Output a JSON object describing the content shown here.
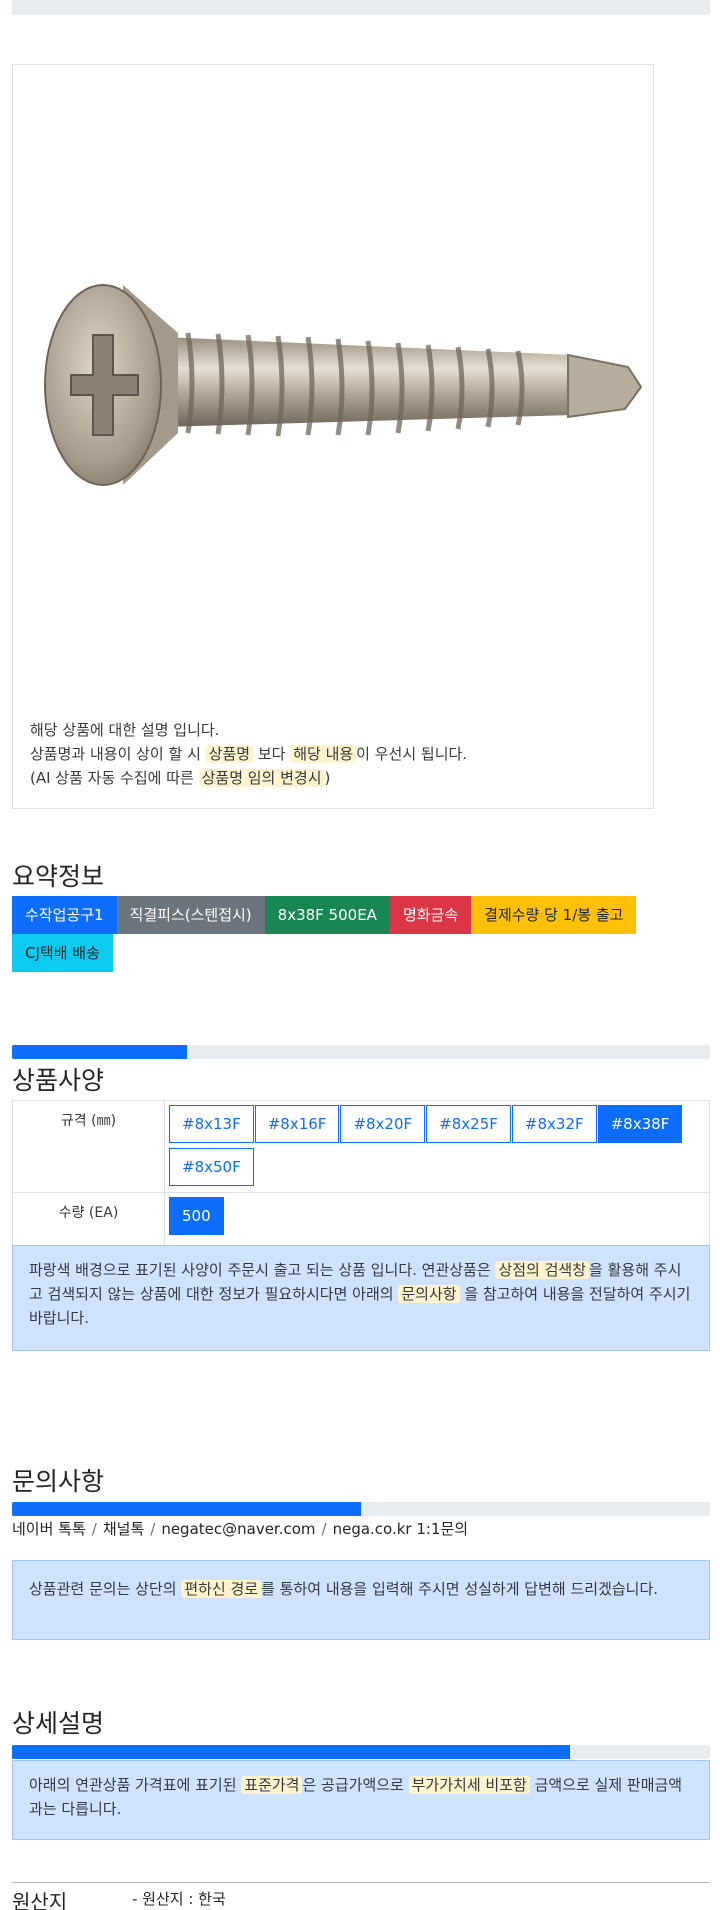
{
  "product_card": {
    "image_alt": "stainless flat head self-drilling screw",
    "desc_line1": "해당 상품에 대한 설명 입니다.",
    "desc_line2_pre": "상품명과 내용이 상이 할 시 ",
    "desc_line2_hl1": "상품명",
    "desc_line2_mid": " 보다 ",
    "desc_line2_hl2": "해당 내용",
    "desc_line2_post": "이 우선시 됩니다.",
    "desc_line3_pre": "(AI 상품 자동 수집에 따른 ",
    "desc_line3_hl": "상품명 임의 변경시",
    "desc_line3_post": ")"
  },
  "summary": {
    "title": "요약정보",
    "badges": [
      {
        "label": "수작업공구1",
        "color": "#0d6efd",
        "text_color": "#ffffff"
      },
      {
        "label": "직결피스(스텐접시)",
        "color": "#6c757d",
        "text_color": "#ffffff"
      },
      {
        "label": "8x38F 500EA",
        "color": "#198754",
        "text_color": "#ffffff"
      },
      {
        "label": "명화금속",
        "color": "#dc3545",
        "text_color": "#ffffff"
      },
      {
        "label": "결제수량 당 1/봉 출고",
        "color": "#ffc107",
        "text_color": "#212529"
      },
      {
        "label": "CJ택배 배송",
        "color": "#0dcaf0",
        "text_color": "#212529"
      }
    ]
  },
  "spec": {
    "title": "상품사양",
    "progress": 0.25,
    "size_label": "규격 (㎜)",
    "size_options": [
      {
        "label": "#8x13F",
        "selected": false
      },
      {
        "label": "#8x16F",
        "selected": false
      },
      {
        "label": "#8x20F",
        "selected": false
      },
      {
        "label": "#8x25F",
        "selected": false
      },
      {
        "label": "#8x32F",
        "selected": false
      },
      {
        "label": "#8x38F",
        "selected": true
      },
      {
        "label": "#8x50F",
        "selected": false
      }
    ],
    "qty_label": "수량 (EA)",
    "qty_options": [
      {
        "label": "500",
        "selected": true
      }
    ],
    "notice_pre": "파랑색 배경으로 표기된 사양이 주문시 출고 되는 상품 입니다. 연관상품은 ",
    "notice_hl1": "상점의 검색창",
    "notice_mid": "을 활용해 주시고 검색되지 않는 상품에 대한 정보가 필요하시다면 아래의 ",
    "notice_hl2": "문의사항",
    "notice_post": " 을 참고하여 내용을 전달하여 주시기 바랍니다."
  },
  "inquiry": {
    "title": "문의사항",
    "progress": 0.5,
    "links": [
      "네이버 톡톡",
      "채널톡",
      "negatec@naver.com",
      "nega.co.kr 1:1문의"
    ],
    "notice_pre": "상품관련 문의는 상단의 ",
    "notice_hl": "편하신 경로",
    "notice_post": "를 통하여 내용을 입력해 주시면 성실하게 답변해 드리겠습니다."
  },
  "detail": {
    "title": "상세설명",
    "progress": 0.8,
    "notice_pre": "아래의 연관상품 가격표에 표기된 ",
    "notice_hl1": "표준가격",
    "notice_mid": "은 공급가액으로 ",
    "notice_hl2": "부가가치세 비포함",
    "notice_post": " 금액으로 실제 판매금액과는 다릅니다."
  },
  "origin": {
    "title": "원산지",
    "value": "- 원산지 : 한국"
  }
}
